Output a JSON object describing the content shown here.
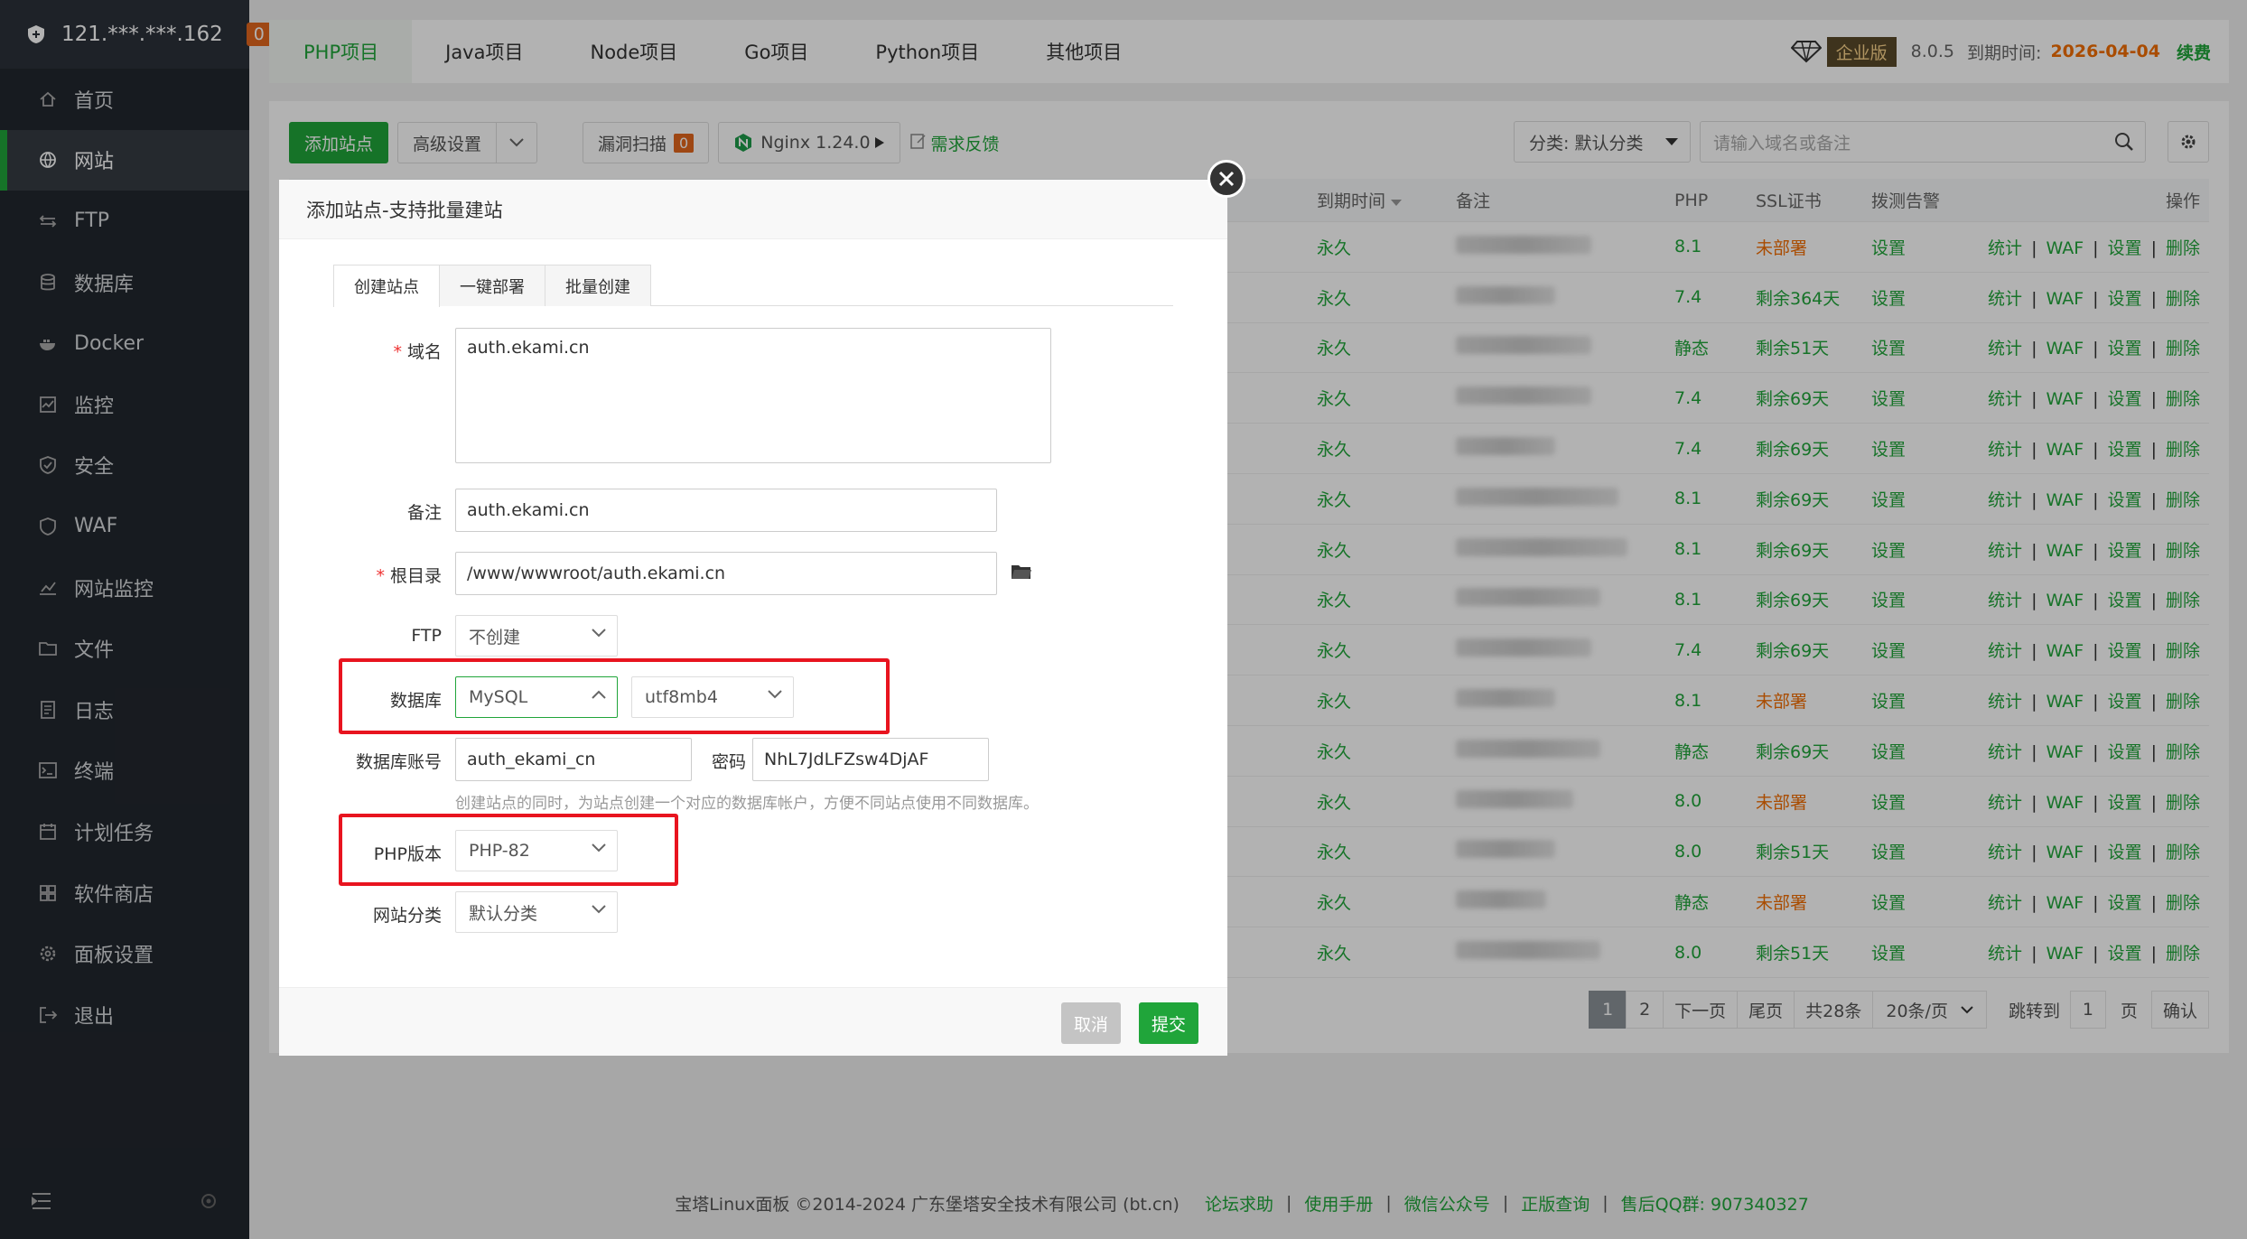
{
  "sidebar": {
    "server_ip": "121.***.***.162",
    "notif_count": "0",
    "items": [
      {
        "label": "首页",
        "icon": "home-icon"
      },
      {
        "label": "网站",
        "icon": "globe-icon"
      },
      {
        "label": "FTP",
        "icon": "ftp-icon"
      },
      {
        "label": "数据库",
        "icon": "database-icon"
      },
      {
        "label": "Docker",
        "icon": "docker-icon"
      },
      {
        "label": "监控",
        "icon": "monitor-icon"
      },
      {
        "label": "安全",
        "icon": "shield-icon"
      },
      {
        "label": "WAF",
        "icon": "waf-icon"
      },
      {
        "label": "网站监控",
        "icon": "chart-icon"
      },
      {
        "label": "文件",
        "icon": "folder-icon"
      },
      {
        "label": "日志",
        "icon": "log-icon"
      },
      {
        "label": "终端",
        "icon": "terminal-icon"
      },
      {
        "label": "计划任务",
        "icon": "calendar-icon"
      },
      {
        "label": "软件商店",
        "icon": "apps-icon"
      },
      {
        "label": "面板设置",
        "icon": "gear-icon"
      },
      {
        "label": "退出",
        "icon": "logout-icon"
      }
    ]
  },
  "topnav": {
    "tabs": [
      "PHP项目",
      "Java项目",
      "Node项目",
      "Go项目",
      "Python项目",
      "其他项目"
    ],
    "edition": "企业版",
    "version": "8.0.5",
    "expire_label": "到期时间:",
    "expire_date": "2026-04-04",
    "renew": "续费"
  },
  "toolbar": {
    "add_site": "添加站点",
    "advanced": "高级设置",
    "vuln_scan": "漏洞扫描",
    "vuln_count": "0",
    "nginx": "Nginx 1.24.0",
    "feedback": "需求反馈",
    "category": "分类: 默认分类",
    "search_placeholder": "请输入域名或备注"
  },
  "table": {
    "headers": {
      "expire": "到期时间",
      "note": "备注",
      "php": "PHP",
      "ssl": "SSL证书",
      "alarm": "拨测告警",
      "ops": "操作"
    },
    "ops": [
      "统计",
      "WAF",
      "设置",
      "删除"
    ],
    "rows": [
      {
        "expire": "永久",
        "php": "8.1",
        "ssl": "未部署",
        "alarm": "设置"
      },
      {
        "expire": "永久",
        "php": "7.4",
        "ssl": "剩余364天",
        "alarm": "设置"
      },
      {
        "expire": "永久",
        "php": "静态",
        "ssl": "剩余51天",
        "alarm": "设置"
      },
      {
        "expire": "永久",
        "php": "7.4",
        "ssl": "剩余69天",
        "alarm": "设置"
      },
      {
        "expire": "永久",
        "php": "7.4",
        "ssl": "剩余69天",
        "alarm": "设置"
      },
      {
        "expire": "永久",
        "php": "8.1",
        "ssl": "剩余69天",
        "alarm": "设置"
      },
      {
        "expire": "永久",
        "php": "8.1",
        "ssl": "剩余69天",
        "alarm": "设置"
      },
      {
        "expire": "永久",
        "php": "8.1",
        "ssl": "剩余69天",
        "alarm": "设置"
      },
      {
        "expire": "永久",
        "php": "7.4",
        "ssl": "剩余69天",
        "alarm": "设置"
      },
      {
        "expire": "永久",
        "php": "8.1",
        "ssl": "未部署",
        "alarm": "设置"
      },
      {
        "expire": "永久",
        "php": "静态",
        "ssl": "剩余69天",
        "alarm": "设置"
      },
      {
        "expire": "永久",
        "php": "8.0",
        "ssl": "未部署",
        "alarm": "设置"
      },
      {
        "expire": "永久",
        "php": "8.0",
        "ssl": "剩余51天",
        "alarm": "设置"
      },
      {
        "expire": "永久",
        "php": "静态",
        "ssl": "未部署",
        "alarm": "设置"
      },
      {
        "expire": "永久",
        "php": "8.0",
        "ssl": "剩余51天",
        "alarm": "设置"
      }
    ]
  },
  "pager": {
    "pages": [
      "1",
      "2"
    ],
    "next": "下一页",
    "last": "尾页",
    "total": "共28条",
    "per_page": "20条/页",
    "jump": "跳转到",
    "jump_value": "1",
    "page_unit": "页",
    "confirm": "确认"
  },
  "footer": {
    "copyright": "宝塔Linux面板 ©2014-2024 广东堡塔安全技术有限公司 (bt.cn)",
    "links": [
      "论坛求助",
      "使用手册",
      "微信公众号",
      "正版查询"
    ],
    "qq": "售后QQ群: 907340327"
  },
  "modal": {
    "title": "添加站点-支持批量建站",
    "tabs": [
      "创建站点",
      "一键部署",
      "批量创建"
    ],
    "domain_label": "域名",
    "domain_value": "auth.ekami.cn",
    "note_label": "备注",
    "note_value": "auth.ekami.cn",
    "root_label": "根目录",
    "root_value": "/www/wwwroot/auth.ekami.cn",
    "ftp_label": "FTP",
    "ftp_value": "不创建",
    "db_label": "数据库",
    "db_type": "MySQL",
    "db_charset": "utf8mb4",
    "db_account_label": "数据库账号",
    "db_account_value": "auth_ekami_cn",
    "pwd_label": "密码",
    "pwd_value": "NhL7JdLFZsw4DjAF",
    "db_hint": "创建站点的同时，为站点创建一个对应的数据库帐户，方便不同站点使用不同数据库。",
    "php_label": "PHP版本",
    "php_value": "PHP-82",
    "category_label": "网站分类",
    "category_value": "默认分类",
    "cancel": "取消",
    "submit": "提交"
  },
  "colors": {
    "brand": "#20a53a",
    "warn": "#f36e02",
    "highlight": "#e8141f",
    "sidebar": "#22272e"
  }
}
